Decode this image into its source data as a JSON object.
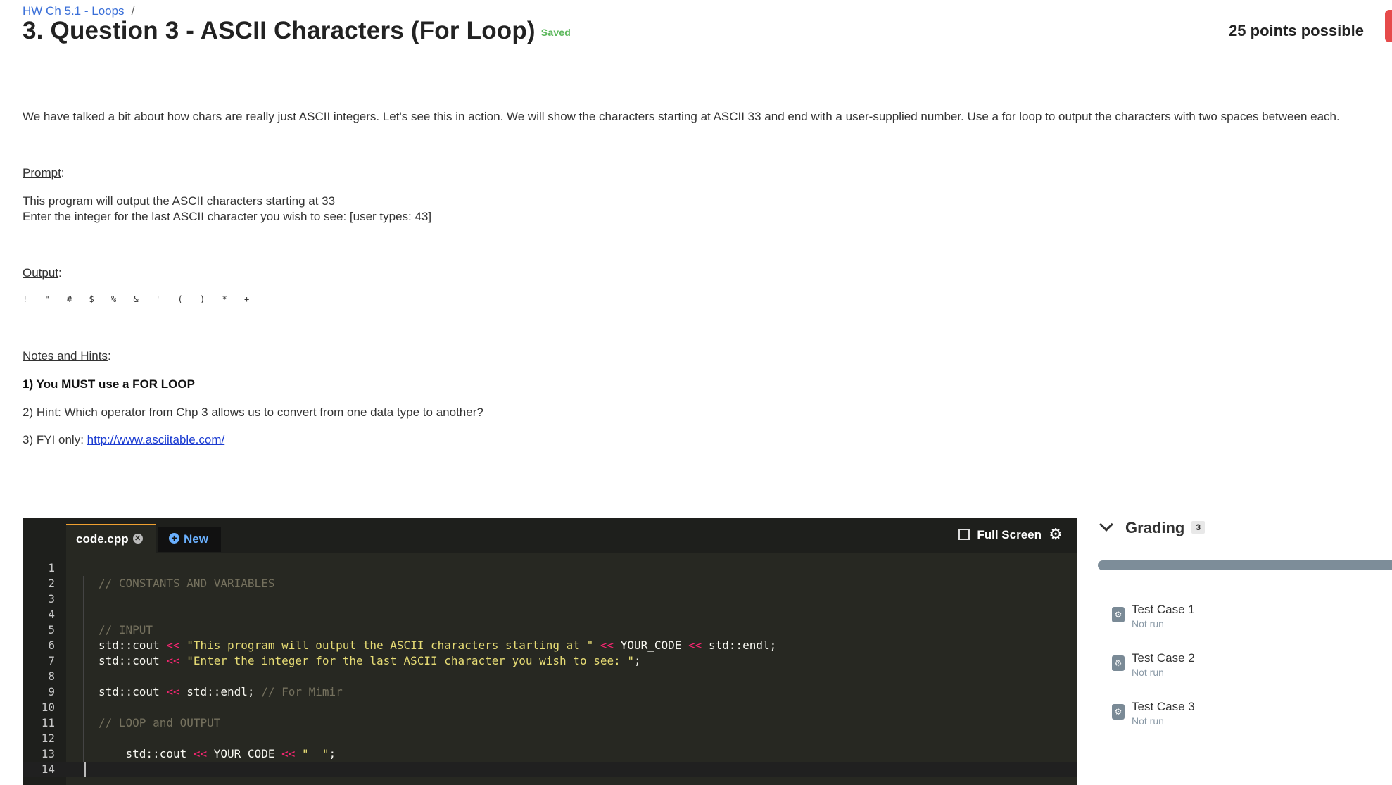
{
  "header": {
    "breadcrumb": "HW Ch 5.1 - Loops",
    "breadcrumb_sep": "/",
    "title": "3. Question 3 - ASCII Characters (For Loop)",
    "saved": "Saved",
    "points": "25 points possible"
  },
  "description": {
    "intro": "We have talked a bit about how chars are really just ASCII integers. Let's see this in action. We will show the characters starting at ASCII 33 and end with a user-supplied number. Use a for loop to output the characters with two spaces between each.",
    "prompt_heading": "Prompt",
    "prompt_line1": "This program will output the ASCII characters starting at 33",
    "prompt_line2": "Enter the integer for the last ASCII character you wish to see:     [user types: 43]",
    "output_heading": "Output",
    "output_chars": [
      "!",
      "\"",
      "#",
      "$",
      "%",
      "&",
      "'",
      "(",
      ")",
      "*",
      "+"
    ],
    "notes_heading": "Notes and Hints",
    "note1": "1) You MUST use a FOR LOOP",
    "note2": "2) Hint: Which operator from Chp 3 allows us to convert from one data type to another?",
    "note3_prefix": "3) FYI only: ",
    "note3_link": "http://www.asciitable.com/"
  },
  "editor": {
    "file_tab": "code.cpp",
    "new_tab": "New",
    "fullscreen": "Full Screen",
    "lines": [
      {
        "n": "1",
        "html": ""
      },
      {
        "n": "2",
        "html": "<span class=\"cm\">// CONSTANTS AND VARIABLES</span>"
      },
      {
        "n": "3",
        "html": ""
      },
      {
        "n": "4",
        "html": ""
      },
      {
        "n": "5",
        "html": "<span class=\"cm\">// INPUT</span>"
      },
      {
        "n": "6",
        "html": "std::cout <span class=\"op\">&lt;&lt;</span> <span class=\"str\">\"This program will output the ASCII characters starting at \"</span> <span class=\"op\">&lt;&lt;</span> YOUR_CODE <span class=\"op\">&lt;&lt;</span> std::endl;"
      },
      {
        "n": "7",
        "html": "std::cout <span class=\"op\">&lt;&lt;</span> <span class=\"str\">\"Enter the integer for the last ASCII character you wish to see: \"</span>;"
      },
      {
        "n": "8",
        "html": ""
      },
      {
        "n": "9",
        "html": "std::cout <span class=\"op\">&lt;&lt;</span> std::endl; <span class=\"cm\">// For Mimir</span>"
      },
      {
        "n": "10",
        "html": ""
      },
      {
        "n": "11",
        "html": "<span class=\"cm\">// LOOP and OUTPUT</span>"
      },
      {
        "n": "12",
        "html": ""
      },
      {
        "n": "13",
        "html": "    std::cout <span class=\"op\">&lt;&lt;</span> YOUR_CODE <span class=\"op\">&lt;&lt;</span> <span class=\"str\">\"  \"</span>;"
      },
      {
        "n": "14",
        "html": ""
      }
    ]
  },
  "grading": {
    "title": "Grading",
    "count": "3",
    "tests": [
      {
        "name": "Test Case 1",
        "status": "Not run"
      },
      {
        "name": "Test Case 2",
        "status": "Not run"
      },
      {
        "name": "Test Case 3",
        "status": "Not run"
      }
    ]
  }
}
